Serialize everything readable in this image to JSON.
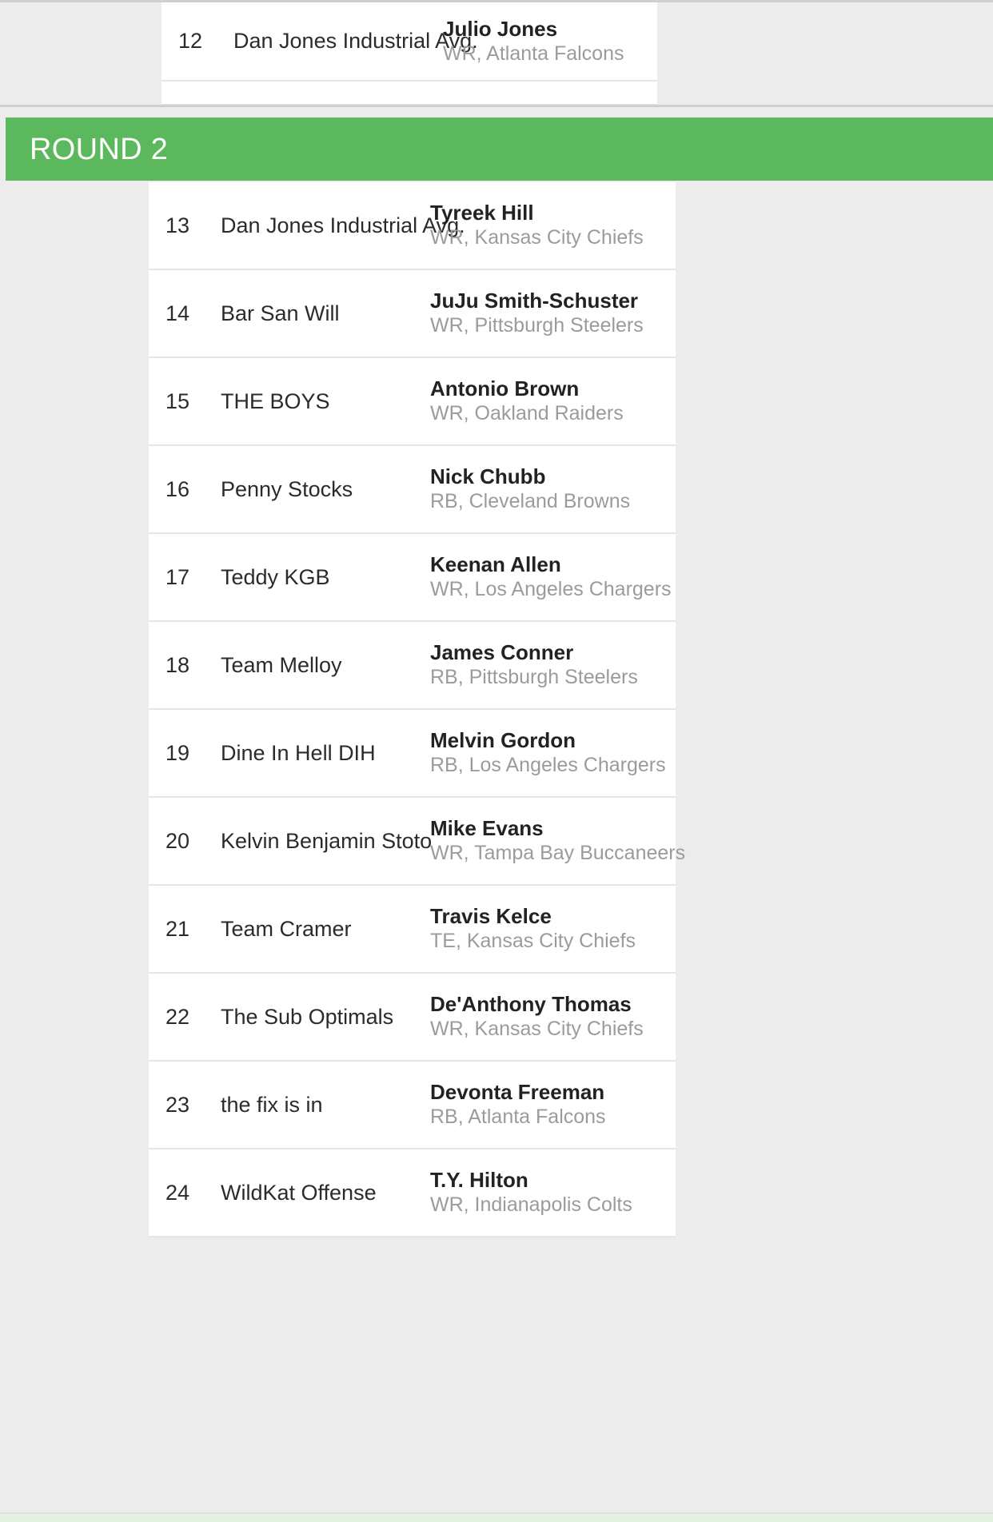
{
  "background_color": "#ececec",
  "accent_color": "#5cb85c",
  "highlight_row_color": "#e4f0e2",
  "previous_round": {
    "picks": [
      {
        "number": "12",
        "owner": "Dan Jones Industrial Avg.",
        "player_name": "Julio Jones",
        "player_meta": "WR, Atlanta Falcons"
      }
    ]
  },
  "round_header": {
    "label": "ROUND 2"
  },
  "round2": {
    "picks": [
      {
        "number": "13",
        "owner": "Dan Jones Industrial Avg.",
        "player_name": "Tyreek Hill",
        "player_meta": "WR, Kansas City Chiefs"
      },
      {
        "number": "14",
        "owner": "Bar San Will",
        "player_name": "JuJu Smith-Schuster",
        "player_meta": "WR, Pittsburgh Steelers"
      },
      {
        "number": "15",
        "owner": "THE BOYS",
        "player_name": "Antonio Brown",
        "player_meta": "WR, Oakland Raiders"
      },
      {
        "number": "16",
        "owner": "Penny Stocks",
        "player_name": "Nick Chubb",
        "player_meta": "RB, Cleveland Browns"
      },
      {
        "number": "17",
        "owner": "Teddy KGB",
        "player_name": "Keenan Allen",
        "player_meta": "WR, Los Angeles Chargers"
      },
      {
        "number": "18",
        "owner": "Team Melloy",
        "player_name": "James Conner",
        "player_meta": "RB, Pittsburgh Steelers"
      },
      {
        "number": "19",
        "owner": "Dine In Hell DIH",
        "player_name": "Melvin Gordon",
        "player_meta": "RB, Los Angeles Chargers"
      },
      {
        "number": "20",
        "owner": "Kelvin Benjamin Stoto",
        "player_name": "Mike Evans",
        "player_meta": "WR, Tampa Bay Buccaneers"
      },
      {
        "number": "21",
        "owner": "Team Cramer",
        "player_name": "Travis Kelce",
        "player_meta": "TE, Kansas City Chiefs"
      },
      {
        "number": "22",
        "owner": "The Sub Optimals",
        "player_name": "De'Anthony Thomas",
        "player_meta": "WR, Kansas City Chiefs"
      },
      {
        "number": "23",
        "owner": "the fix is in",
        "player_name": "Devonta Freeman",
        "player_meta": "RB, Atlanta Falcons"
      },
      {
        "number": "24",
        "owner": "WildKat Offense",
        "player_name": "T.Y. Hilton",
        "player_meta": "WR, Indianapolis Colts"
      }
    ]
  }
}
